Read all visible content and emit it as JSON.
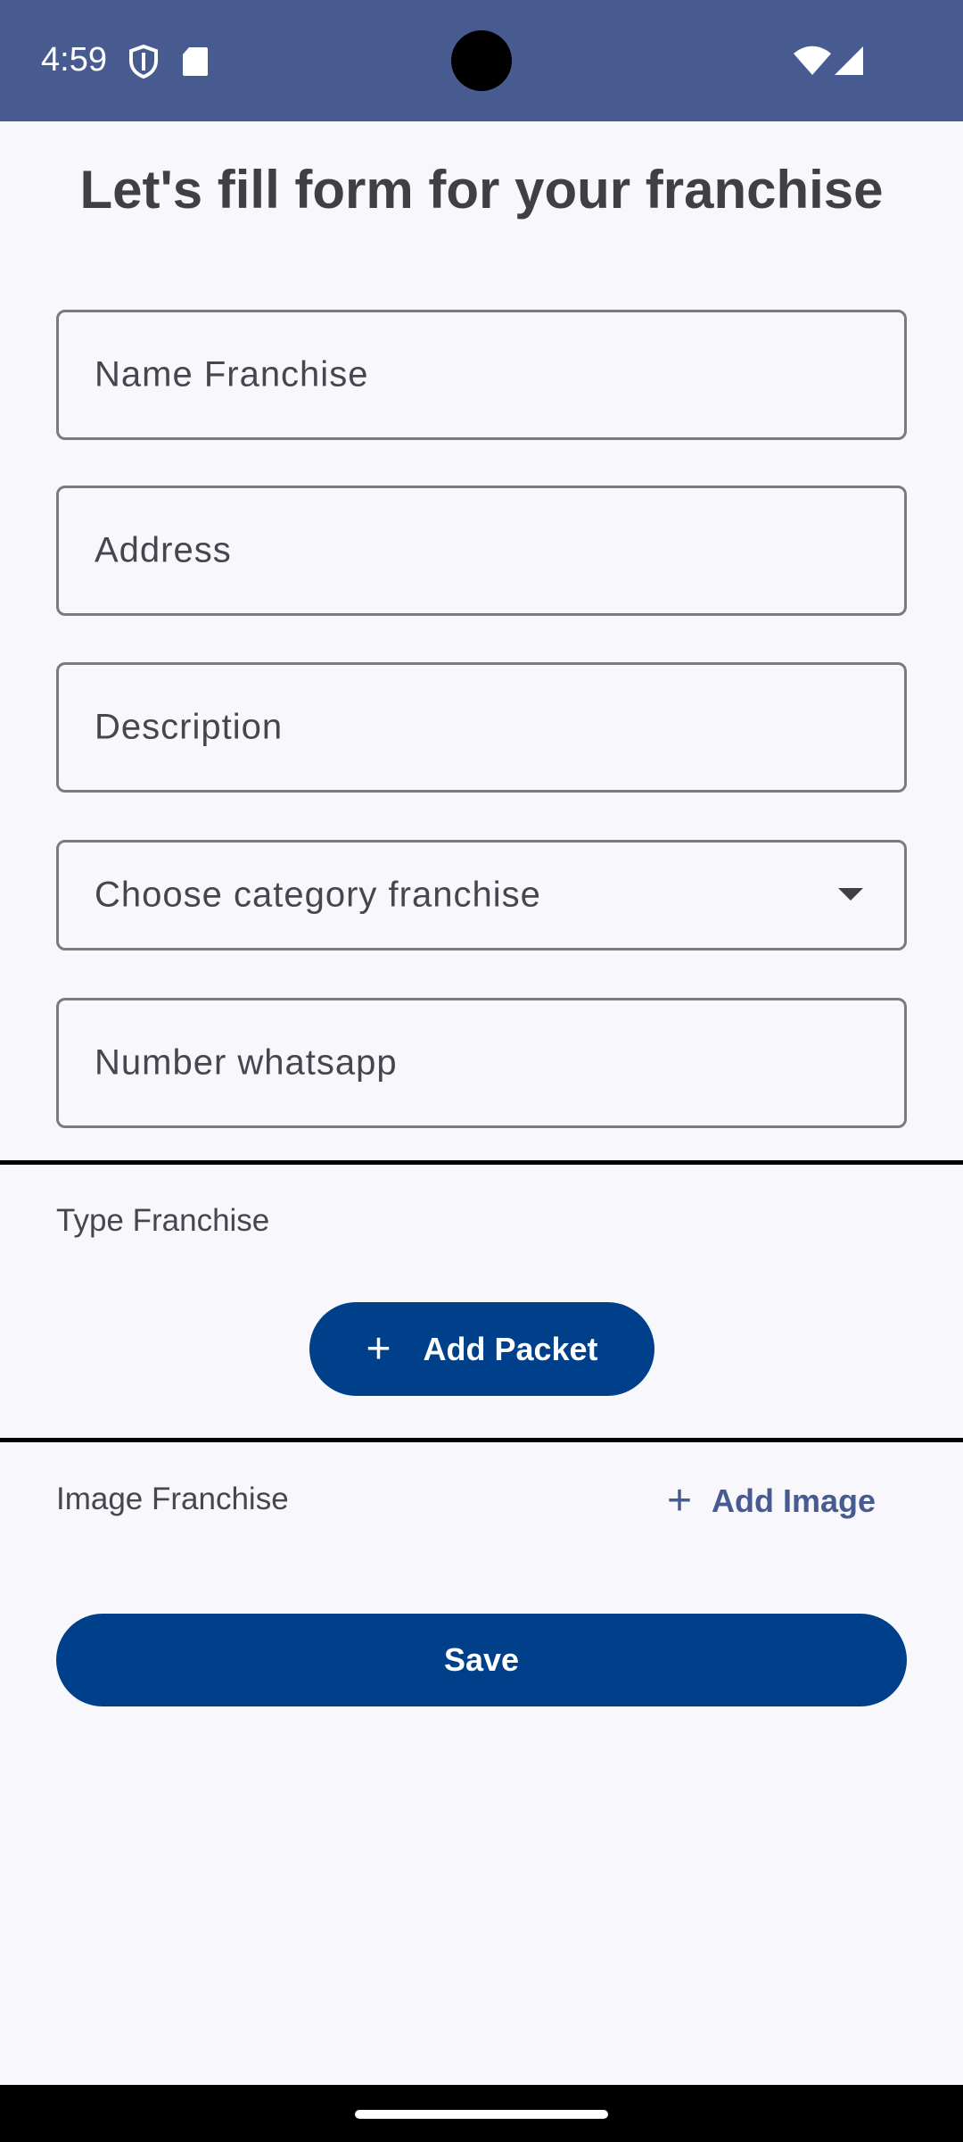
{
  "status_bar": {
    "time": "4:59",
    "icons": [
      "shield-icon",
      "sd-card-icon",
      "wifi-icon",
      "cellular-signal-icon"
    ],
    "background": "#475b91"
  },
  "page": {
    "title": "Let's fill form for your franchise"
  },
  "form": {
    "name_placeholder": "Name Franchise",
    "address_placeholder": "Address",
    "description_placeholder": "Description",
    "category_placeholder": "Choose category franchise",
    "whatsapp_placeholder": "Number whatsapp"
  },
  "type_section": {
    "label": "Type Franchise",
    "add_button_label": "Add Packet"
  },
  "image_section": {
    "label": "Image Franchise",
    "add_button_label": "Add Image"
  },
  "actions": {
    "save_label": "Save"
  },
  "colors": {
    "primary": "#003f8a",
    "accent_text": "#475b91",
    "background": "#f8f7fc"
  }
}
